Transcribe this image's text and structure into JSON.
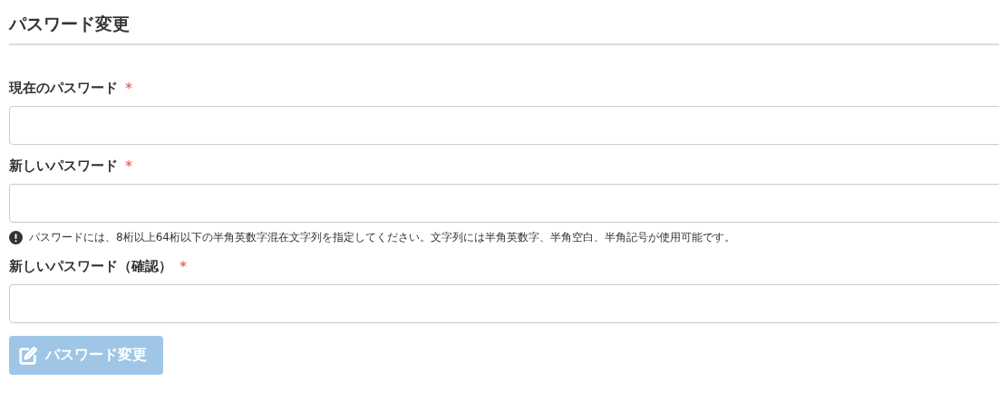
{
  "title": "パスワード変更",
  "fields": [
    {
      "label": "現在のパスワード",
      "required_mark": "*"
    },
    {
      "label": "新しいパスワード",
      "required_mark": "*",
      "help": "パスワードには、8桁以上64桁以下の半角英数字混在文字列を指定してください。文字列には半角英数字、半角空白、半角記号が使用可能です。"
    },
    {
      "label": "新しいパスワード（確認）",
      "required_mark": "*"
    }
  ],
  "submit": {
    "label": "パスワード変更",
    "disabled": true
  }
}
